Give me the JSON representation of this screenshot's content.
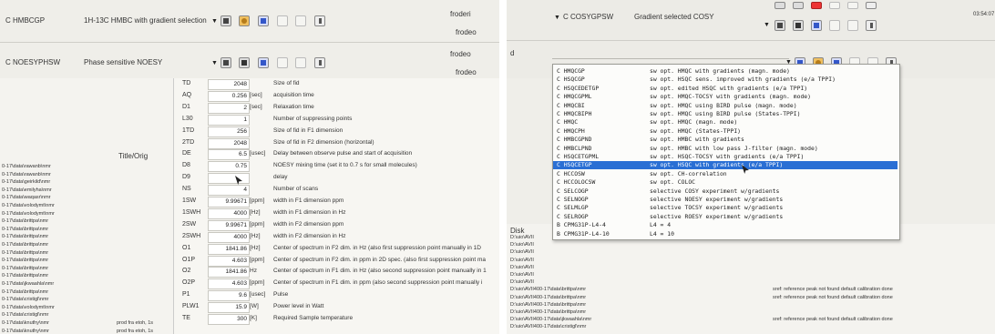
{
  "left_panel": {
    "experiments": [
      {
        "name": "C HMBCGP",
        "title": "1H-13C HMBC with gradient selection",
        "user": "froderi"
      },
      {
        "name": "C NOESYPHSW",
        "title": "Phase sensitive NOESY",
        "user": "frodeo"
      }
    ],
    "parameters": [
      {
        "name": "TD",
        "value": "2048",
        "unit": "",
        "desc": "Size of fid"
      },
      {
        "name": "AQ",
        "value": "0.256",
        "unit": "[sec]",
        "desc": "acquisition time"
      },
      {
        "name": "D1",
        "value": "2",
        "unit": "[sec]",
        "desc": "Relaxation time"
      },
      {
        "name": "L30",
        "value": "1",
        "unit": "",
        "desc": "Number of suppressing points"
      },
      {
        "name": "1TD",
        "value": "256",
        "unit": "",
        "desc": "Size of fid in F1 dimension"
      },
      {
        "name": "2TD",
        "value": "2048",
        "unit": "",
        "desc": "Size of fid in F2 dimension (horizontal)"
      },
      {
        "name": "DE",
        "value": "6.5",
        "unit": "[usec]",
        "desc": "Delay between observe pulse and start of acquisition"
      },
      {
        "name": "D8",
        "value": "0.75",
        "unit": "",
        "desc": "NOESY mixing time (set it to 0.7 s for small molecules)"
      },
      {
        "name": "D9",
        "value": "",
        "unit": "",
        "desc": "delay"
      },
      {
        "name": "NS",
        "value": "4",
        "unit": "",
        "desc": "Number of scans"
      },
      {
        "name": "1SW",
        "value": "9.99671",
        "unit": "[ppm]",
        "desc": "width in F1 dimension ppm"
      },
      {
        "name": "1SWH",
        "value": "4000",
        "unit": "[Hz]",
        "desc": "width in F1 dimension in Hz"
      },
      {
        "name": "2SW",
        "value": "9.99671",
        "unit": "[ppm]",
        "desc": "width in F2 dimension ppm"
      },
      {
        "name": "2SWH",
        "value": "4000",
        "unit": "[Hz]",
        "desc": "width in F2 dimension in Hz"
      },
      {
        "name": "O1",
        "value": "1841.86",
        "unit": "[Hz]",
        "desc": "Center of spectrum in F2 dim. in Hz (also first suppression point manually in 1D"
      },
      {
        "name": "O1P",
        "value": "4.603",
        "unit": "[ppm]",
        "desc": "Center of spectrum in F2 dim. in ppm in 2D spec. (also first suppression point ma"
      },
      {
        "name": "O2",
        "value": "1841.86",
        "unit": "Hz",
        "desc": "Center of spectrum in F1 dim. in Hz (also second suppression point manually in 1"
      },
      {
        "name": "O2P",
        "value": "4.603",
        "unit": "[ppm]",
        "desc": "Center of spectrum in F1 dim. in ppm (also second suppression point manually i"
      },
      {
        "name": "P1",
        "value": "9.6",
        "unit": "[usec]",
        "desc": "Pulse"
      },
      {
        "name": "PLW1",
        "value": "15.9",
        "unit": "[W]",
        "desc": "Power level in Watt"
      },
      {
        "name": "TE",
        "value": "300",
        "unit": "[K]",
        "desc": "Required Sample temperature"
      }
    ],
    "title_col_header": "Title/Orig",
    "files": [
      {
        "path": "0-17\\data\\rawanb\\nmr",
        "title": ""
      },
      {
        "path": "0-17\\data\\rawanb\\nmr",
        "title": ""
      },
      {
        "path": "0-17\\data\\geirkild\\nmr",
        "title": ""
      },
      {
        "path": "0-17\\data\\emilyha\\nmr",
        "title": ""
      },
      {
        "path": "0-17\\data\\waqasr\\nmr",
        "title": ""
      },
      {
        "path": "0-17\\data\\volodymt\\nmr",
        "title": ""
      },
      {
        "path": "0-17\\data\\volodymt\\nmr",
        "title": ""
      },
      {
        "path": "0-17\\data\\brittpa\\nmr",
        "title": ""
      },
      {
        "path": "0-17\\data\\brittpa\\nmr",
        "title": ""
      },
      {
        "path": "0-17\\data\\brittpa\\nmr",
        "title": ""
      },
      {
        "path": "0-17\\data\\brittpa\\nmr",
        "title": ""
      },
      {
        "path": "0-17\\data\\brittpa\\nmr",
        "title": ""
      },
      {
        "path": "0-17\\data\\brittpa\\nmr",
        "title": ""
      },
      {
        "path": "0-17\\data\\brittpa\\nmr",
        "title": ""
      },
      {
        "path": "0-17\\data\\brittpa\\nmr",
        "title": ""
      },
      {
        "path": "0-17\\data\\jkwaahla\\nmr",
        "title": ""
      },
      {
        "path": "0-17\\data\\brittpa\\nmr",
        "title": ""
      },
      {
        "path": "0-17\\data\\cristigl\\nmr",
        "title": ""
      },
      {
        "path": "0-17\\data\\volodymt\\nmr",
        "title": ""
      },
      {
        "path": "0-17\\data\\cristigl\\nmr",
        "title": ""
      },
      {
        "path": "0-17\\data\\knuthy\\nmr",
        "title": "prod fra etoh, 1s"
      },
      {
        "path": "0-17\\data\\knuthy\\nmr",
        "title": "prod fra etoh, 1s"
      }
    ]
  },
  "right_panel": {
    "experiments": [
      {
        "name": "C COSYGPSW",
        "title": "Gradient selected COSY"
      },
      {
        "name": "d",
        "title": ""
      }
    ],
    "clock": "03:54:07",
    "list": [
      {
        "code": "C HMQCGP",
        "desc": "sw opt. HMQC with gradients (magn. mode)"
      },
      {
        "code": "C HSQCGP",
        "desc": "sw opt. HSQC sens. improved with gradients (e/a TPPI)"
      },
      {
        "code": "C HSQCEDETGP",
        "desc": "sw opt. edited HSQC with gradients (e/a TPPI)"
      },
      {
        "code": "C HMQCGPML",
        "desc": "sw opt. HMQC-TOCSY with gradients (magn. mode)"
      },
      {
        "code": "C HMQCBI",
        "desc": "sw opt. HMQC using BIRD pulse (magn. mode)"
      },
      {
        "code": "C HMQCBIPH",
        "desc": "sw opt. HMQC using BIRD pulse (States-TPPI)"
      },
      {
        "code": "C HMQC",
        "desc": "sw opt. HMQC (magn. mode)"
      },
      {
        "code": "C HMQCPH",
        "desc": "sw opt. HMQC (States-TPPI)"
      },
      {
        "code": "C HMBCGPND",
        "desc": "sw opt. HMBC with gradients"
      },
      {
        "code": "C HMBCLPND",
        "desc": "sw opt. HMBC with low pass J-filter (magn. mode)"
      },
      {
        "code": "C HSQCETGPML",
        "desc": "sw opt. HSQC-TOCSY with gradients (e/a TPPI)"
      },
      {
        "code": "C HSQCETGP",
        "desc": "sw opt. HSQC with gradients (e/a TPPI)"
      },
      {
        "code": "C HCCOSW",
        "desc": "sw opt. CH-correlation"
      },
      {
        "code": "C HCCOLOCSW",
        "desc": "sw opt. COLOC"
      },
      {
        "code": "C SELCOGP",
        "desc": "selective COSY experiment w/gradients"
      },
      {
        "code": "C SELNOGP",
        "desc": "selective NOESY experiment w/gradients"
      },
      {
        "code": "C SELMLGP",
        "desc": "selective TOCSY experiment w/gradients"
      },
      {
        "code": "C SELROGP",
        "desc": "selective ROESY experiment w/gradients"
      },
      {
        "code": "B CPMG31P-L4-4",
        "desc": "L4 = 4"
      },
      {
        "code": "B CPMG31P-L4-10",
        "desc": "L4 = 10"
      }
    ],
    "selected_index": 11,
    "disk_header": "Disk",
    "disk_paths": [
      "D:\\uio\\AVII",
      "D:\\uio\\AVII",
      "D:\\uio\\AVII",
      "D:\\uio\\AVII",
      "D:\\uio\\AVII",
      "D:\\uio\\AVII",
      "D:\\uio\\AVII",
      "D:\\uio\\AVII400-17\\data\\brittpa\\nmr",
      "D:\\uio\\AVII400-17\\data\\brittpa\\nmr",
      "D:\\uio\\AVII400-17\\data\\brittpa\\nmr",
      "D:\\uio\\AVII400-17\\data\\brittpa\\nmr",
      "D:\\uio\\AVII400-17\\data\\jkwaahla\\nmr",
      "D:\\uio\\AVII400-17\\data\\cristigl\\nmr"
    ],
    "notes": [
      {
        "row": 7,
        "text": "sref: reference peak not found default calibration done"
      },
      {
        "row": 8,
        "text": "sref: reference peak not found default calibration done"
      },
      {
        "row": 11,
        "text": "sref: reference peak not found default calibration done"
      }
    ]
  },
  "colors": {
    "selected_row": "#2a6fd4",
    "toolbar_blue": "#3457c9",
    "toolbar_orange": "#e8a325"
  }
}
